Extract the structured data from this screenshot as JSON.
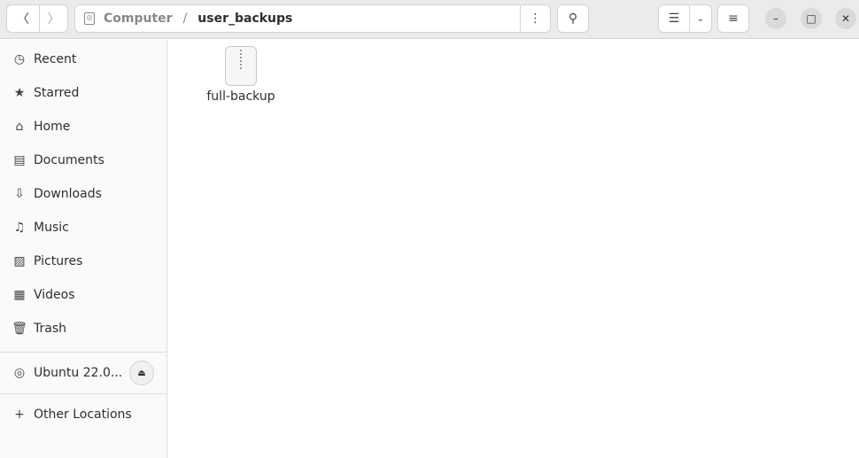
{
  "header": {
    "path": [
      "Computer",
      "user_backups"
    ],
    "separator": "/"
  },
  "sidebar": {
    "items": [
      {
        "label": "Recent",
        "icon": "clock-icon",
        "glyph": "◷"
      },
      {
        "label": "Starred",
        "icon": "star-icon",
        "glyph": "★"
      },
      {
        "label": "Home",
        "icon": "home-icon",
        "glyph": "⌂"
      },
      {
        "label": "Documents",
        "icon": "document-icon",
        "glyph": "▤"
      },
      {
        "label": "Downloads",
        "icon": "download-icon",
        "glyph": "⇩"
      },
      {
        "label": "Music",
        "icon": "music-icon",
        "glyph": "♫"
      },
      {
        "label": "Pictures",
        "icon": "picture-icon",
        "glyph": "▨"
      },
      {
        "label": "Videos",
        "icon": "video-icon",
        "glyph": "▦"
      },
      {
        "label": "Trash",
        "icon": "trash-icon",
        "glyph": "🗑"
      }
    ],
    "drive": {
      "label": "Ubuntu 22.0...",
      "icon": "disc-icon"
    },
    "other": {
      "label": "Other Locations",
      "icon": "plus-icon"
    }
  },
  "files": [
    {
      "name": "full-backup",
      "icon": "zip-archive-icon"
    }
  ]
}
